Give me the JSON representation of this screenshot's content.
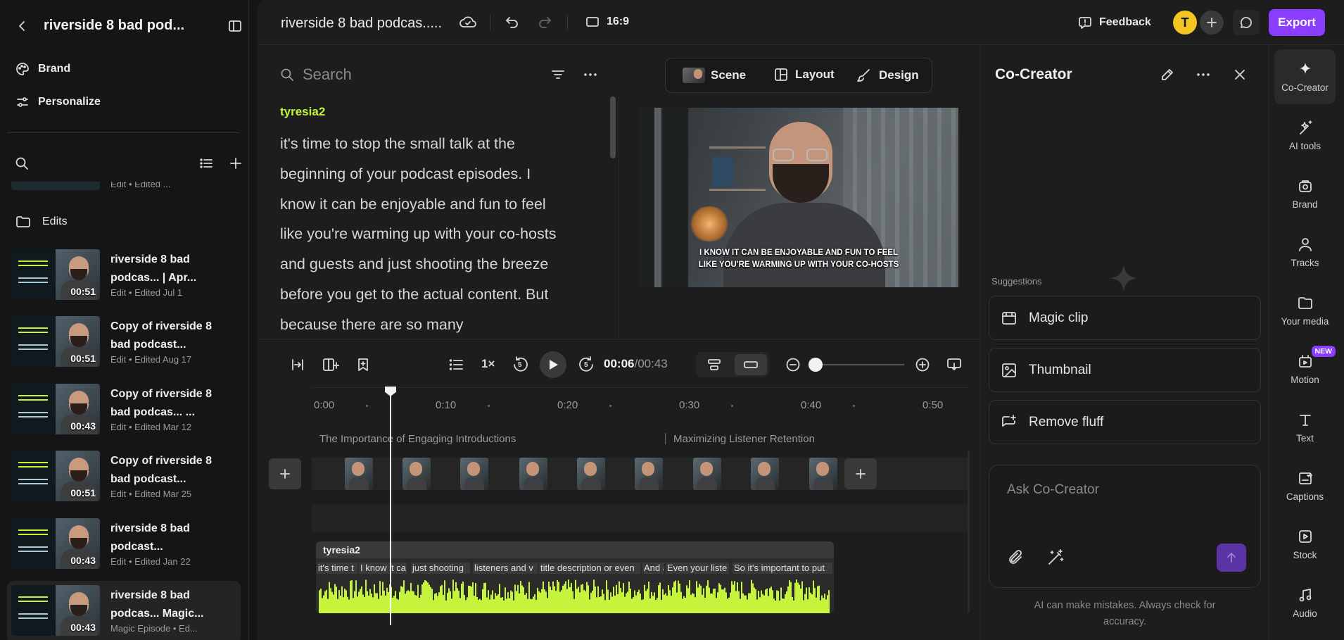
{
  "sidebar": {
    "title": "riverside 8 bad pod...",
    "menu": [
      {
        "label": "Brand",
        "icon": "palette-icon"
      },
      {
        "label": "Personalize",
        "icon": "sliders-icon"
      }
    ],
    "folder_label": "Edits",
    "partial_meta": "Edit • Edited ...",
    "edits": [
      {
        "title": "riverside 8 bad podcas... | Apr...",
        "meta": "Edit • Edited Jul 1",
        "duration": "00:51"
      },
      {
        "title": "Copy of riverside 8 bad podcast...",
        "meta": "Edit • Edited Aug 17",
        "duration": "00:51"
      },
      {
        "title": "Copy of riverside 8 bad podcas... ...",
        "meta": "Edit • Edited Mar 12",
        "duration": "00:43"
      },
      {
        "title": "Copy of riverside 8 bad podcast...",
        "meta": "Edit • Edited Mar 25",
        "duration": "00:51"
      },
      {
        "title": "riverside 8 bad podcast...",
        "meta": "Edit • Edited Jan 22",
        "duration": "00:43"
      },
      {
        "title": "riverside 8 bad podcas... Magic...",
        "meta": "Magic Episode • Ed...",
        "duration": "00:43"
      }
    ]
  },
  "topbar": {
    "project_title": "riverside 8 bad podcas.....",
    "aspect_ratio": "16:9",
    "feedback_label": "Feedback",
    "avatar_initial": "T",
    "export_label": "Export"
  },
  "transcript": {
    "search_placeholder": "Search",
    "speaker": "tyresia2",
    "text": "it's time to stop the small talk at the beginning of your podcast episodes. I know it can be enjoyable and fun to feel like you're warming up with your co-hosts and guests and just shooting the breeze before you get to the actual content. But because there are so many"
  },
  "preview": {
    "tabs": [
      "Scene",
      "Layout",
      "Design"
    ],
    "caption_line1": "I KNOW IT CAN BE ENJOYABLE AND FUN TO FEEL",
    "caption_line2": "LIKE YOU'RE WARMING UP WITH YOUR CO-HOSTS"
  },
  "player": {
    "speed": "1×",
    "current_time": "00:06",
    "total_time": "/00:43",
    "skip_back": "5",
    "skip_fwd": "5",
    "zoom_level": 0.0
  },
  "timeline": {
    "ticks": [
      "0:00",
      "0:10",
      "0:20",
      "0:30",
      "0:40",
      "0:50"
    ],
    "chapters": [
      "The Importance of Engaging Introductions",
      "Maximizing Listener Retention"
    ],
    "track_name": "tyresia2",
    "words": [
      "it's time t",
      "I know it ca",
      "just shooting",
      "listeners and v",
      "title description or even",
      "And a",
      "Even your liste",
      "So it's important to put"
    ]
  },
  "cocreator": {
    "title": "Co-Creator",
    "suggestions_label": "Suggestions",
    "suggestions": [
      "Magic clip",
      "Thumbnail",
      "Remove fluff"
    ],
    "input_placeholder": "Ask Co-Creator",
    "disclaimer": "AI can make mistakes. Always check for accuracy."
  },
  "rail": [
    {
      "label": "Co-Creator",
      "icon": "sparkle-icon"
    },
    {
      "label": "AI tools",
      "icon": "magic-icon"
    },
    {
      "label": "Brand",
      "icon": "brand-icon"
    },
    {
      "label": "Tracks",
      "icon": "person-icon"
    },
    {
      "label": "Your media",
      "icon": "folder-icon"
    },
    {
      "label": "Motion",
      "icon": "motion-icon",
      "badge": "NEW"
    },
    {
      "label": "Text",
      "icon": "text-icon"
    },
    {
      "label": "Captions",
      "icon": "captions-icon"
    },
    {
      "label": "Stock",
      "icon": "stock-icon"
    },
    {
      "label": "Audio",
      "icon": "music-icon"
    }
  ],
  "colors": {
    "accent": "#8b3dff",
    "avatar": "#f3c623",
    "waveform": "#c6f33c",
    "speaker": "#c6f33c"
  }
}
